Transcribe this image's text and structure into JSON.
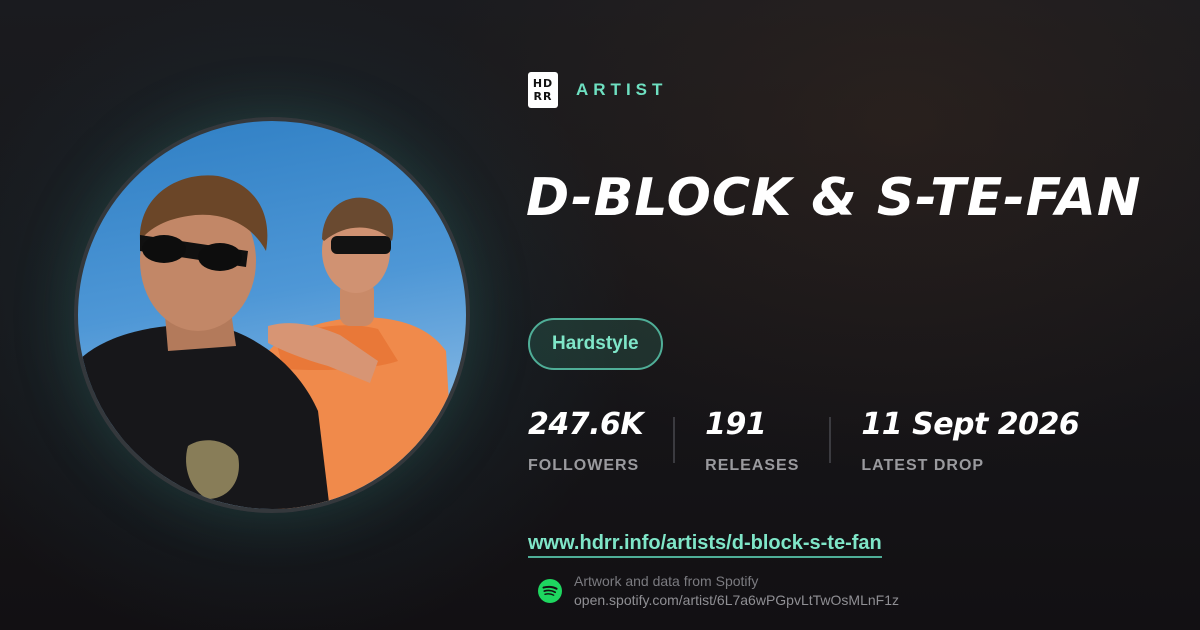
{
  "brand": {
    "logo_lines": [
      "HD",
      "RR"
    ],
    "kicker": "ARTIST"
  },
  "artist": {
    "name": "D-BLOCK & S-TE-FAN",
    "genre": "Hardstyle",
    "photo_icon": "artist-photo"
  },
  "stats": [
    {
      "value": "247.6K",
      "label": "FOLLOWERS"
    },
    {
      "value": "191",
      "label": "RELEASES"
    },
    {
      "value": "11 Sept 2026",
      "label": "LATEST DROP"
    }
  ],
  "link": {
    "text": "www.hdrr.info/artists/d-block-s-te-fan"
  },
  "source": {
    "icon": "spotify-icon",
    "caption": "Artwork and data from Spotify",
    "url": "open.spotify.com/artist/6L7a6wPGpvLtTwOsMLnF1z"
  },
  "colors": {
    "accent": "#6ee0c1",
    "chip_border": "#4fae97",
    "background": "#161518",
    "spotify_green": "#1ed760"
  }
}
